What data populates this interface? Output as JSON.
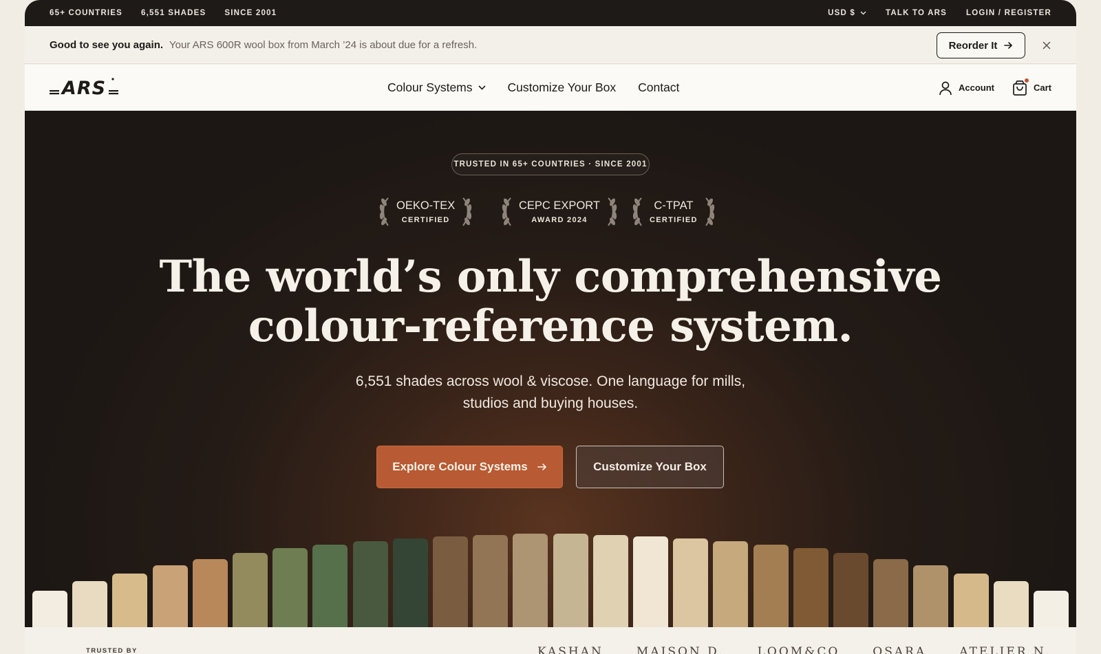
{
  "utility_bar": {
    "stats": [
      "65+ COUNTRIES",
      "6,551 SHADES",
      "SINCE 2001"
    ],
    "currency": "USD $",
    "talk": "TALK TO ARS",
    "login": "LOGIN / REGISTER"
  },
  "banner": {
    "greeting": "Good to see you again.",
    "message": "Your ARS 600R wool box from March ’24 is about due for a refresh.",
    "reorder_label": "Reorder It"
  },
  "nav": {
    "logo_text": "ARS",
    "links": [
      "Colour Systems",
      "Customize Your Box",
      "Contact"
    ],
    "account_label": "Account",
    "cart_label": "Cart"
  },
  "hero": {
    "pill": "TRUSTED IN 65+ COUNTRIES · SINCE 2001",
    "awards": [
      {
        "title": "OEKO-TEX",
        "subtitle": "CERTIFIED"
      },
      {
        "title": "CEPC EXPORT",
        "subtitle": "AWARD 2024"
      },
      {
        "title": "C-TPAT",
        "subtitle": "CERTIFIED"
      }
    ],
    "headline_line1": "The world’s only comprehensive",
    "headline_line2": "colour-reference system.",
    "sub_line1": "6,551 shades across wool & viscose. One language for mills,",
    "sub_line2": "studios and buying houses.",
    "cta_primary": "Explore Colour Systems",
    "cta_secondary": "Customize Your Box",
    "swatch_colors": [
      "#f3ece0",
      "#e8dbc2",
      "#d7bb8b",
      "#c9a277",
      "#b8885a",
      "#938a5e",
      "#6f7d52",
      "#56704c",
      "#48593f",
      "#344535",
      "#7a5c40",
      "#927555",
      "#ad9473",
      "#c6b592",
      "#dfd1b2",
      "#f0e6d3",
      "#dcc6a2",
      "#c6a97d",
      "#a27e52",
      "#7f5a35",
      "#6a4a2e",
      "#8a6a48",
      "#b0926a",
      "#d6b98a",
      "#e9dcc0",
      "#f4efe4"
    ],
    "swatch_levels": [
      0.38,
      0.48,
      0.56,
      0.64,
      0.71,
      0.77,
      0.82,
      0.86,
      0.89,
      0.92,
      0.94,
      0.96,
      0.97,
      0.97,
      0.96,
      0.94,
      0.92,
      0.89,
      0.86,
      0.82,
      0.77,
      0.71,
      0.64,
      0.56,
      0.48,
      0.38
    ]
  },
  "trusted": {
    "label": "TRUSTED BY",
    "brands": [
      "KASHAN",
      "MAISON D.",
      "LOOM&CO",
      "OSARA",
      "ATELIER N."
    ]
  }
}
